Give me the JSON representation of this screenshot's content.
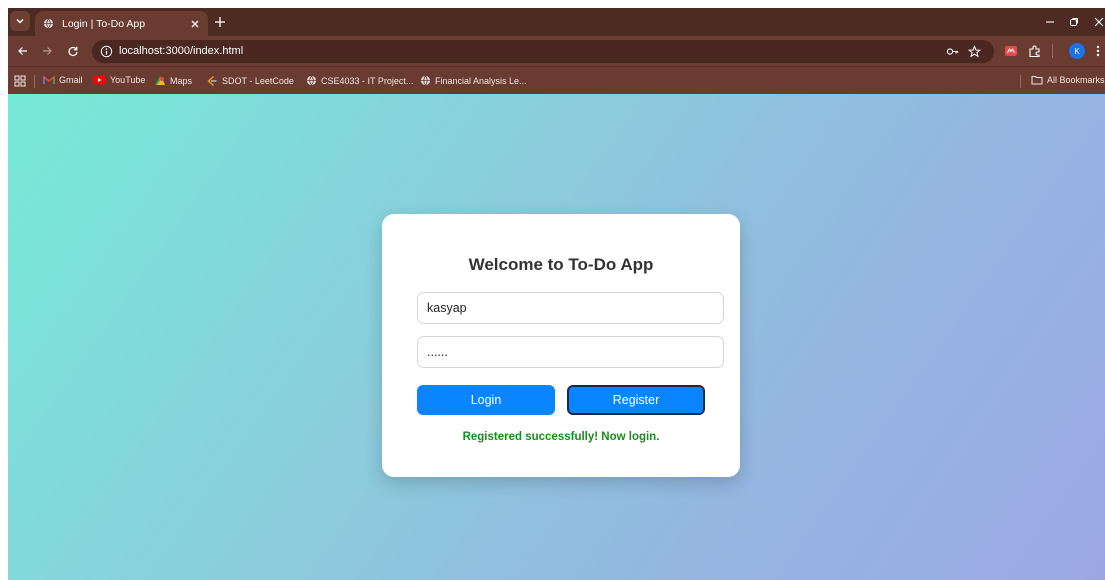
{
  "browser": {
    "tab_title": "Login | To-Do App",
    "url": "localhost:3000/index.html",
    "avatar_letter": "K",
    "bookmarks": [
      "Gmail",
      "YouTube",
      "Maps",
      "SDOT - LeetCode",
      "CSE4033 - IT Project...",
      "Financial Analysis Le..."
    ],
    "all_bookmarks_label": "All Bookmarks"
  },
  "login": {
    "heading": "Welcome to To-Do App",
    "username_value": "kasyap",
    "password_value": "......",
    "login_label": "Login",
    "register_label": "Register",
    "message": "Registered successfully! Now login."
  },
  "colors": {
    "chrome_bg": "#4d2a22",
    "tab_bg": "#6a3b31",
    "button_blue": "#0a84ff",
    "success_green": "#1c8a1c",
    "gradient_start": "#76ead8",
    "gradient_end": "#9ca8e4"
  },
  "icons": {
    "tab": [
      "tab-search-icon",
      "globe-icon",
      "close-icon",
      "plus-icon"
    ],
    "window": [
      "minimize-icon",
      "restore-icon",
      "close-icon"
    ],
    "nav": [
      "back-arrow-icon",
      "forward-arrow-icon",
      "reload-icon",
      "info-icon",
      "key-icon",
      "star-icon",
      "extension-icon",
      "puzzle-icon",
      "more-icon"
    ],
    "bookmarks": [
      "apps-grid-icon",
      "gmail-icon",
      "youtube-icon",
      "maps-icon",
      "leetcode-icon",
      "globe-icon",
      "folder-icon"
    ]
  }
}
